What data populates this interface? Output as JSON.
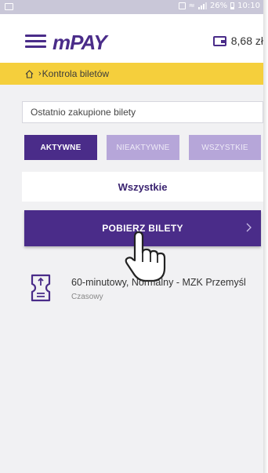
{
  "status_bar": {
    "battery": "26%",
    "time": "10:10"
  },
  "app": {
    "logo": "mPAY",
    "balance": "8,68 zł"
  },
  "breadcrumb": {
    "separator": "›",
    "current": "Kontrola biletów"
  },
  "section": {
    "title": "Ostatnio zakupione bilety"
  },
  "tabs": [
    {
      "label": "AKTYWNE",
      "active": true
    },
    {
      "label": "NIEAKTYWNE",
      "active": false
    },
    {
      "label": "WSZYSTKIE",
      "active": false
    }
  ],
  "filter": {
    "label": "Wszystkie"
  },
  "download_button": {
    "label": "POBIERZ BILETY"
  },
  "tickets": [
    {
      "name": "60-minutowy, Normalny - MZK Przemyśl",
      "type": "Czasowy"
    }
  ],
  "colors": {
    "brand_purple": "#4a2c89",
    "inactive_tab": "#b6a6d9",
    "breadcrumb_yellow": "#f5cf3c",
    "status_bar": "#c9c7d8",
    "page_bg": "#f1f1f3"
  }
}
